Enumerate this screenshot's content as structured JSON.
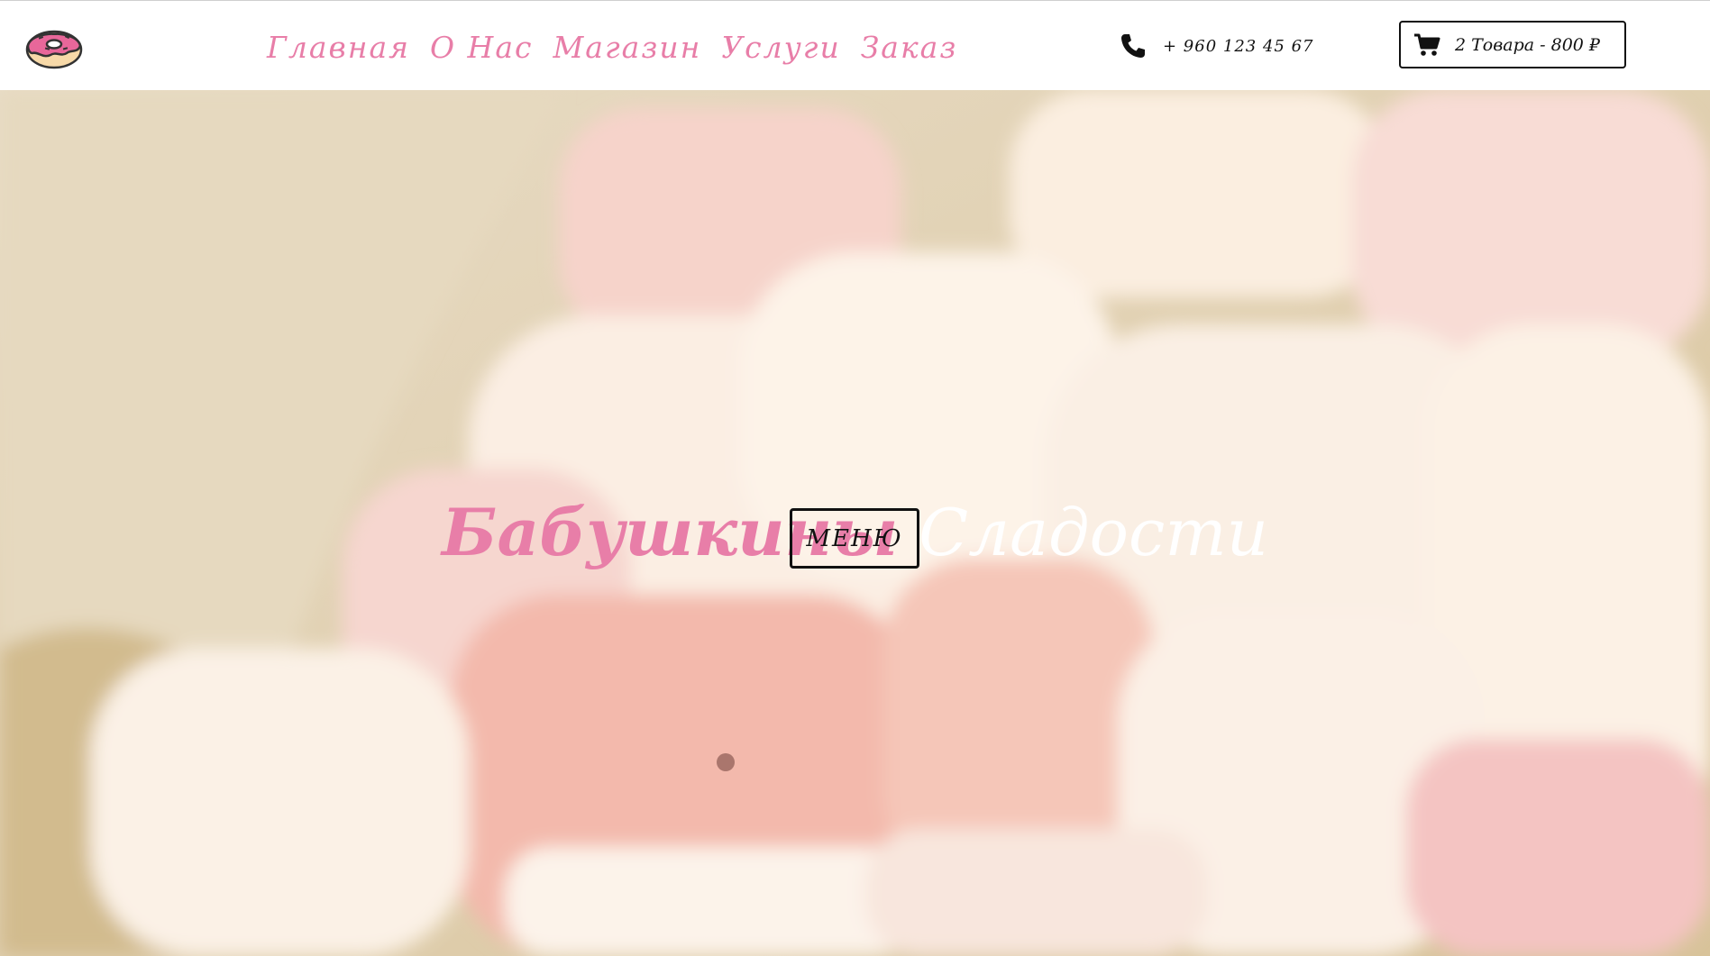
{
  "header": {
    "logo_icon": "donut-icon",
    "nav": [
      {
        "label": "Главная"
      },
      {
        "label": "О Нас"
      },
      {
        "label": "Магазин"
      },
      {
        "label": "Услуги"
      },
      {
        "label": "Заказ"
      }
    ],
    "phone_icon": "phone-icon",
    "phone": "+ 960 123 45 67",
    "cart_icon": "shopping-cart-icon",
    "cart_label": "2 Товара - 800 ₽"
  },
  "hero": {
    "title_part1": "Бабушкины",
    "title_part2": "Сладости",
    "menu_button": "МЕНЮ"
  },
  "colors": {
    "accent_pink": "#e87ea8",
    "text_dark": "#111111",
    "header_bg": "#ffffff"
  }
}
